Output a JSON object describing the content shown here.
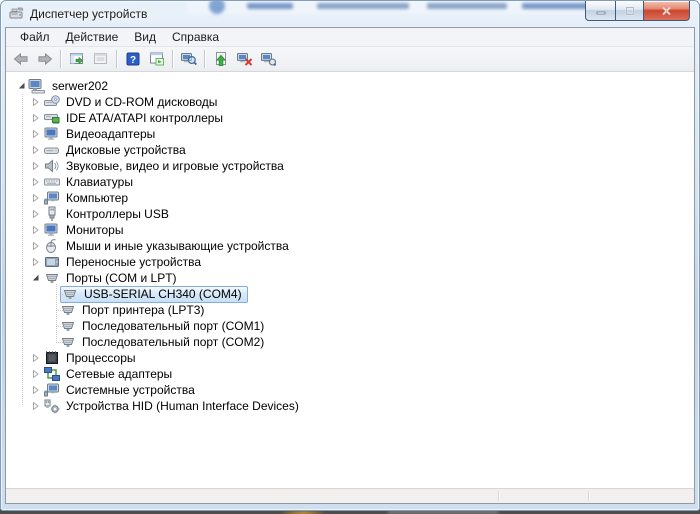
{
  "window": {
    "title": "Диспетчер устройств",
    "app_icon": "device-manager-icon",
    "controls": [
      {
        "name": "minimize",
        "icon": "minimize-icon"
      },
      {
        "name": "maximize",
        "icon": "maximize-icon"
      },
      {
        "name": "close",
        "icon": "close-icon"
      }
    ]
  },
  "menu": {
    "items": [
      {
        "label": "Файл"
      },
      {
        "label": "Действие"
      },
      {
        "label": "Вид"
      },
      {
        "label": "Справка"
      }
    ]
  },
  "toolbar": {
    "buttons": [
      {
        "name": "back",
        "icon": "back-arrow-icon",
        "enabled": false
      },
      {
        "name": "forward",
        "icon": "forward-arrow-icon",
        "enabled": false
      },
      {
        "name": "show-console-tree",
        "icon": "console-tree-icon",
        "enabled": true
      },
      {
        "name": "export-list",
        "icon": "window-icon",
        "enabled": false
      },
      {
        "name": "help",
        "icon": "help-icon",
        "enabled": true
      },
      {
        "name": "action-pane",
        "icon": "action-pane-icon",
        "enabled": true
      },
      {
        "name": "properties",
        "icon": "computer-magnifier-icon",
        "enabled": true
      },
      {
        "name": "update-driver",
        "icon": "update-driver-icon",
        "enabled": true
      },
      {
        "name": "uninstall-device",
        "icon": "uninstall-device-icon",
        "enabled": true
      },
      {
        "name": "scan-hardware-changes",
        "icon": "scan-hardware-icon",
        "enabled": true
      }
    ]
  },
  "tree": {
    "items": [
      {
        "label": "serwer202",
        "level": 0,
        "expander": "expanded",
        "icon": "computer-icon",
        "selected": false
      },
      {
        "label": "DVD и CD-ROM дисководы",
        "level": 1,
        "expander": "collapsed",
        "icon": "dvd-drive-icon",
        "selected": false
      },
      {
        "label": "IDE ATA/ATAPI контроллеры",
        "level": 1,
        "expander": "collapsed",
        "icon": "ide-controller-icon",
        "selected": false
      },
      {
        "label": "Видеоадаптеры",
        "level": 1,
        "expander": "collapsed",
        "icon": "video-adapter-icon",
        "selected": false
      },
      {
        "label": "Дисковые устройства",
        "level": 1,
        "expander": "collapsed",
        "icon": "disk-drive-icon",
        "selected": false
      },
      {
        "label": "Звуковые, видео и игровые устройства",
        "level": 1,
        "expander": "collapsed",
        "icon": "audio-device-icon",
        "selected": false
      },
      {
        "label": "Клавиатуры",
        "level": 1,
        "expander": "collapsed",
        "icon": "keyboard-icon",
        "selected": false
      },
      {
        "label": "Компьютер",
        "level": 1,
        "expander": "collapsed",
        "icon": "computer-icon",
        "selected": false
      },
      {
        "label": "Контроллеры USB",
        "level": 1,
        "expander": "collapsed",
        "icon": "usb-controller-icon",
        "selected": false
      },
      {
        "label": "Мониторы",
        "level": 1,
        "expander": "collapsed",
        "icon": "monitor-icon",
        "selected": false
      },
      {
        "label": "Мыши и иные указывающие устройства",
        "level": 1,
        "expander": "collapsed",
        "icon": "mouse-icon",
        "selected": false
      },
      {
        "label": "Переносные устройства",
        "level": 1,
        "expander": "collapsed",
        "icon": "portable-device-icon",
        "selected": false
      },
      {
        "label": "Порты (COM и LPT)",
        "level": 1,
        "expander": "expanded",
        "icon": "serial-port-icon",
        "selected": false
      },
      {
        "label": "USB-SERIAL CH340 (COM4)",
        "level": 2,
        "expander": "none",
        "icon": "serial-port-icon",
        "selected": true
      },
      {
        "label": "Порт принтера (LPT3)",
        "level": 2,
        "expander": "none",
        "icon": "serial-port-icon",
        "selected": false
      },
      {
        "label": "Последовательный порт (COM1)",
        "level": 2,
        "expander": "none",
        "icon": "serial-port-icon",
        "selected": false
      },
      {
        "label": "Последовательный порт (COM2)",
        "level": 2,
        "expander": "none",
        "icon": "serial-port-icon",
        "selected": false
      },
      {
        "label": "Процессоры",
        "level": 1,
        "expander": "collapsed",
        "icon": "processor-icon",
        "selected": false
      },
      {
        "label": "Сетевые адаптеры",
        "level": 1,
        "expander": "collapsed",
        "icon": "network-adapter-icon",
        "selected": false
      },
      {
        "label": "Системные устройства",
        "level": 1,
        "expander": "collapsed",
        "icon": "system-device-icon",
        "selected": false
      },
      {
        "label": "Устройства HID (Human Interface Devices)",
        "level": 1,
        "expander": "collapsed",
        "icon": "hid-device-icon",
        "selected": false
      }
    ]
  },
  "colors": {
    "titlebar": "#cfdded",
    "frame_border": "#7f9db9",
    "selection_border": "#84acdd",
    "selection_fill": "#d7e9f9",
    "close_button": "#cc4530",
    "help_button": "#2b5ec8",
    "status_bar": "#f1f0ee"
  }
}
